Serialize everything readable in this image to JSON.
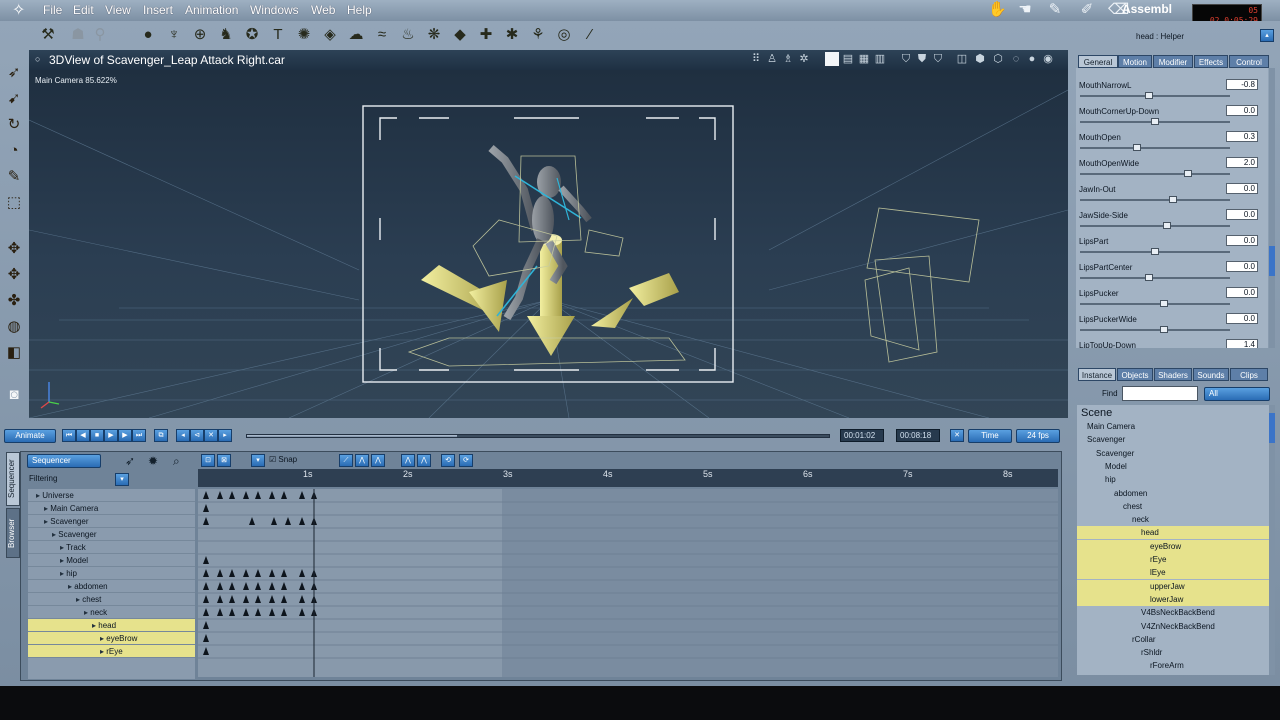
{
  "menubar": {
    "items": [
      "File",
      "Edit",
      "View",
      "Insert",
      "Animation",
      "Windows",
      "Web",
      "Help"
    ],
    "app_name": "Assembl",
    "lcd_frame": "02",
    "lcd_time": "0:05:29",
    "lcd_count": "05"
  },
  "view3d": {
    "title": "3DView of Scavenger_Leap Attack Right.car",
    "camera_label": "Main Camera 85.622%"
  },
  "transport": {
    "animate_label": "Animate",
    "current_time": "00:01:02",
    "total_time": "00:08:18",
    "time_mode": "Time",
    "fps": "24 fps",
    "scrub_position": 0.36
  },
  "sequencer": {
    "mode": "Sequencer",
    "filtering_label": "Filtering",
    "snap_label": "Snap",
    "side_tabs": [
      "Sequencer",
      "Browser"
    ],
    "ruler_ticks": [
      "1s",
      "2s",
      "3s",
      "4s",
      "5s",
      "6s",
      "7s",
      "8s"
    ],
    "tree": [
      {
        "label": "Universe",
        "depth": 0,
        "selected": false
      },
      {
        "label": "Main Camera",
        "depth": 1,
        "selected": false
      },
      {
        "label": "Scavenger",
        "depth": 1,
        "selected": false
      },
      {
        "label": "Scavenger",
        "depth": 2,
        "selected": false
      },
      {
        "label": "Track",
        "depth": 3,
        "selected": false
      },
      {
        "label": "Model",
        "depth": 3,
        "selected": false
      },
      {
        "label": "hip",
        "depth": 3,
        "selected": false
      },
      {
        "label": "abdomen",
        "depth": 4,
        "selected": false
      },
      {
        "label": "chest",
        "depth": 5,
        "selected": false
      },
      {
        "label": "neck",
        "depth": 6,
        "selected": false
      },
      {
        "label": "head",
        "depth": 7,
        "selected": true
      },
      {
        "label": "eyeBrow",
        "depth": 8,
        "selected": true
      },
      {
        "label": "rEye",
        "depth": 8,
        "selected": true
      }
    ]
  },
  "rightpanel": {
    "helper_label": "head : Helper",
    "tabs": [
      "General",
      "Motion",
      "Modifier",
      "Effects",
      "Control"
    ],
    "morphs": [
      {
        "name": "MouthNarrowL",
        "value": "-0.8",
        "knob": 0.46
      },
      {
        "name": "MouthCornerUp-Down",
        "value": "0.0",
        "knob": 0.5
      },
      {
        "name": "MouthOpen",
        "value": "0.3",
        "knob": 0.38
      },
      {
        "name": "MouthOpenWide",
        "value": "2.0",
        "knob": 0.72
      },
      {
        "name": "JawIn-Out",
        "value": "0.0",
        "knob": 0.62
      },
      {
        "name": "JawSide-Side",
        "value": "0.0",
        "knob": 0.58
      },
      {
        "name": "LipsPart",
        "value": "0.0",
        "knob": 0.5
      },
      {
        "name": "LipsPartCenter",
        "value": "0.0",
        "knob": 0.46
      },
      {
        "name": "LipsPucker",
        "value": "0.0",
        "knob": 0.56
      },
      {
        "name": "LipsPuckerWide",
        "value": "0.0",
        "knob": 0.56
      },
      {
        "name": "LipTopUp-Down",
        "value": "1.4",
        "knob": 0.6
      }
    ],
    "scene_tabs": [
      "Instance",
      "Objects",
      "Shaders",
      "Sounds",
      "Clips"
    ],
    "find_label": "Find",
    "find_value": "",
    "find_filter": "All",
    "scene_title": "Scene",
    "scene_tree": [
      {
        "label": "Main Camera",
        "depth": 0,
        "selected": false
      },
      {
        "label": "Scavenger",
        "depth": 0,
        "selected": false
      },
      {
        "label": "Scavenger",
        "depth": 1,
        "selected": false
      },
      {
        "label": "Model",
        "depth": 2,
        "selected": false
      },
      {
        "label": "hip",
        "depth": 2,
        "selected": false
      },
      {
        "label": "abdomen",
        "depth": 3,
        "selected": false
      },
      {
        "label": "chest",
        "depth": 4,
        "selected": false
      },
      {
        "label": "neck",
        "depth": 5,
        "selected": false
      },
      {
        "label": "head",
        "depth": 6,
        "selected": true
      },
      {
        "label": "eyeBrow",
        "depth": 7,
        "selected": true
      },
      {
        "label": "rEye",
        "depth": 7,
        "selected": true
      },
      {
        "label": "lEye",
        "depth": 7,
        "selected": true
      },
      {
        "label": "upperJaw",
        "depth": 7,
        "selected": true
      },
      {
        "label": "lowerJaw",
        "depth": 7,
        "selected": true
      },
      {
        "label": "V4BsNeckBackBend",
        "depth": 6,
        "selected": false
      },
      {
        "label": "V4ZnNeckBackBend",
        "depth": 6,
        "selected": false
      },
      {
        "label": "rCollar",
        "depth": 5,
        "selected": false
      },
      {
        "label": "rShldr",
        "depth": 6,
        "selected": false
      },
      {
        "label": "rForeArm",
        "depth": 7,
        "selected": false
      }
    ]
  },
  "colors": {
    "accent_blue": "#2a6cb4",
    "selection_yellow": "#e6e28c",
    "viewport_bg": "#2b3e52"
  }
}
